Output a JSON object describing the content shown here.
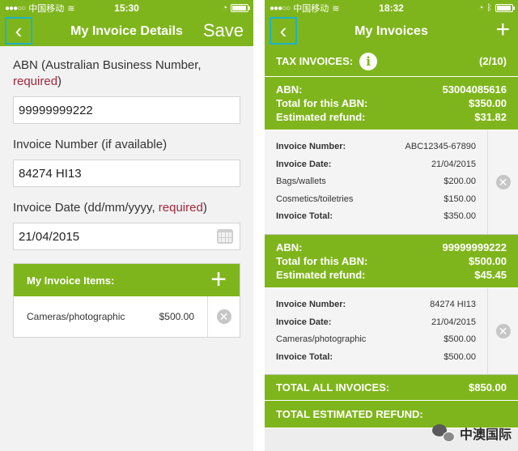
{
  "left": {
    "status": {
      "carrier": "中国移动",
      "time": "15:30"
    },
    "nav": {
      "back": "‹",
      "title": "My Invoice Details",
      "save": "Save"
    },
    "form": {
      "abn_label": "ABN (Australian Business Number,",
      "abn_required": "required",
      "abn_label_close": ")",
      "abn_value": "99999999222",
      "invoice_number_label": "Invoice Number (if available)",
      "invoice_number_value": "84274 HI13",
      "invoice_date_label": "Invoice Date (dd/mm/yyyy,",
      "invoice_date_required": "required",
      "invoice_date_label_close": ")",
      "invoice_date_value": "21/04/2015"
    },
    "items": {
      "header": "My Invoice Items:",
      "add": "+",
      "rows": [
        {
          "name": "Cameras/photographic",
          "amount": "$500.00"
        }
      ]
    }
  },
  "right": {
    "status": {
      "carrier": "中国移动",
      "time": "18:32"
    },
    "nav": {
      "back": "‹",
      "title": "My Invoices",
      "add": "+"
    },
    "tax_invoices": {
      "label": "TAX INVOICES:",
      "info": "i",
      "count": "(2/10)"
    },
    "groups": [
      {
        "abn_label": "ABN:",
        "abn": "53004085616",
        "total_label": "Total for this ABN:",
        "total": "$350.00",
        "refund_label": "Estimated refund:",
        "refund": "$31.82",
        "invoice": [
          {
            "k": "Invoice Number:",
            "v": "ABC12345-67890",
            "bold": true
          },
          {
            "k": "Invoice Date:",
            "v": "21/04/2015",
            "bold": true
          },
          {
            "k": "Bags/wallets",
            "v": "$200.00",
            "bold": false
          },
          {
            "k": "Cosmetics/toiletries",
            "v": "$150.00",
            "bold": false
          },
          {
            "k": "Invoice Total:",
            "v": "$350.00",
            "bold": true
          }
        ]
      },
      {
        "abn_label": "ABN:",
        "abn": "99999999222",
        "total_label": "Total for this ABN:",
        "total": "$500.00",
        "refund_label": "Estimated refund:",
        "refund": "$45.45",
        "invoice": [
          {
            "k": "Invoice Number:",
            "v": "84274 HI13",
            "bold": true
          },
          {
            "k": "Invoice Date:",
            "v": "21/04/2015",
            "bold": true
          },
          {
            "k": "Cameras/photographic",
            "v": "$500.00",
            "bold": false
          },
          {
            "k": "Invoice Total:",
            "v": "$500.00",
            "bold": true
          }
        ]
      }
    ],
    "totals": {
      "all_label": "TOTAL ALL INVOICES:",
      "all_value": "$850.00",
      "refund_label": "TOTAL ESTIMATED REFUND:"
    },
    "watermark": "中澳国际"
  },
  "icons": {
    "back": "chevron-left-icon",
    "delete": "close-circle-icon",
    "calendar": "calendar-icon",
    "info": "info-icon",
    "wifi": "wifi-icon",
    "battery": "battery-icon"
  },
  "colors": {
    "brand_green": "#7fb51c",
    "required_red": "#a0283c",
    "highlight_cyan": "#1bb3c8"
  }
}
